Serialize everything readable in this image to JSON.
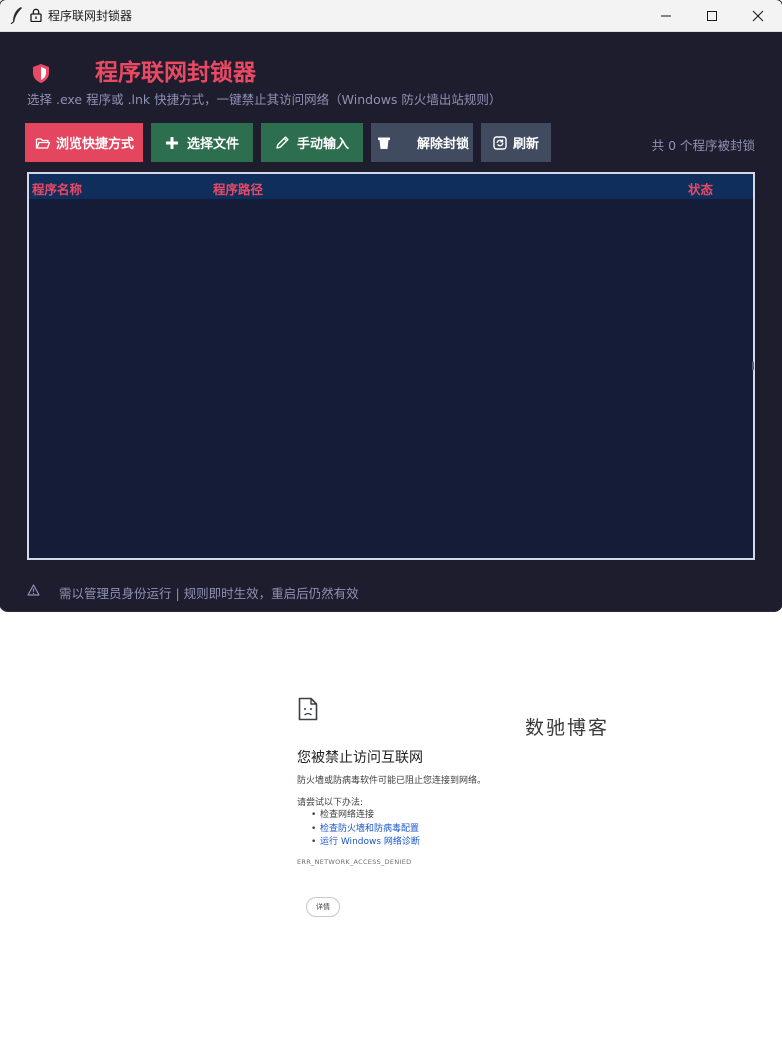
{
  "window": {
    "title": "程序联网封锁器",
    "controls": [
      "minimize-icon",
      "maximize-icon",
      "close-icon"
    ]
  },
  "header": {
    "title": "程序联网封锁器",
    "subtitle": "选择 .exe 程序或 .lnk 快捷方式，一键禁止其访问网络（Windows 防火墙出站规则）",
    "icon": "shield-icon"
  },
  "toolbar": {
    "browse_label": "浏览快捷方式",
    "select_file_label": "选择文件",
    "manual_input_label": "手动输入",
    "unblock_label": "解除封锁",
    "refresh_label": "刷新",
    "blocked_count_text": "共 0 个程序被封锁"
  },
  "table": {
    "columns": [
      "程序名称",
      "程序路径",
      "状态"
    ],
    "rows": []
  },
  "footer": {
    "text": "需以管理员身份运行  |  规则即时生效，重启后仍然有效",
    "icon": "warning-icon"
  },
  "error_page": {
    "icon": "sad-document-icon",
    "title": "您被禁止访问互联网",
    "description": "防火墙或防病毒软件可能已阻止您连接到网络。",
    "try_label": "请尝试以下办法:",
    "suggestions": [
      {
        "text": "检查网络连接",
        "link": false
      },
      {
        "text": "检查防火墙和防病毒配置",
        "link": true
      },
      {
        "text": "运行 Windows 网络诊断",
        "link": true
      }
    ],
    "error_code": "ERR_NETWORK_ACCESS_DENIED",
    "button_label": "详情"
  },
  "watermark": "数驰博客",
  "colors": {
    "window_bg": "#1e1d2e",
    "accent": "#ea4963",
    "green_button": "#2c6e4d",
    "gray_button": "#414b5f",
    "table_bg": "#151c37",
    "table_header_bg": "#0f2e5c",
    "muted_text": "#8e91b4",
    "link": "#1a55c8"
  }
}
